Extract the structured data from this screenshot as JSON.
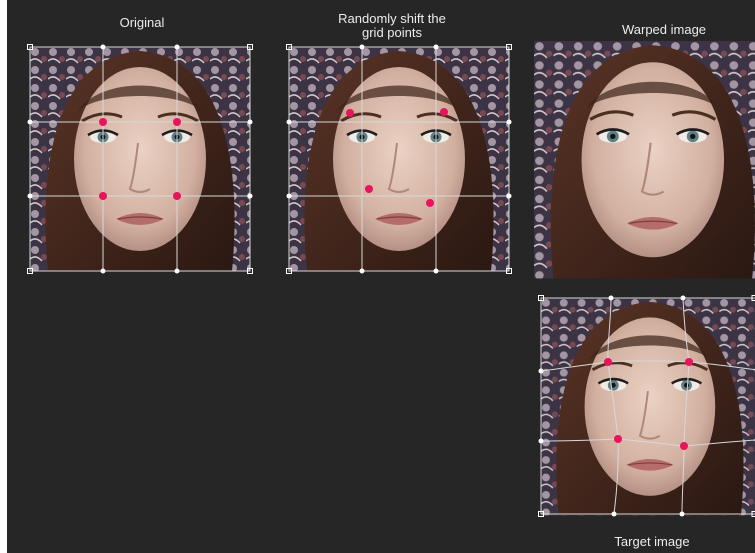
{
  "titles": {
    "original": "Original",
    "shift_line1": "Randomly shift the",
    "shift_line2": "grid points",
    "warped": "Warped image",
    "target": "Target image"
  },
  "colors": {
    "background": "#262626",
    "grid_line": "#d8d8d8",
    "control_point": "#e8145c",
    "handle": "#ffffff"
  }
}
